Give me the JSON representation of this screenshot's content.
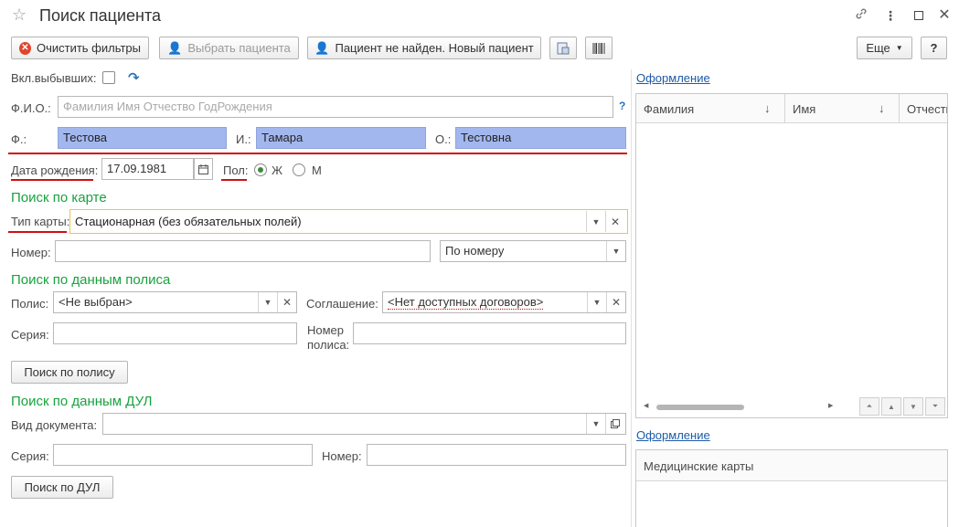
{
  "window": {
    "title": "Поиск пациента",
    "icons": {
      "favorite": "star-icon",
      "link": "link-icon",
      "menu": "more-vertical-icon",
      "maximize": "maximize-icon",
      "close": "close-icon"
    }
  },
  "toolbar": {
    "clear_filters": "Очистить фильтры",
    "select_patient": "Выбрать пациента",
    "new_patient": "Пациент не найден. Новый пациент",
    "more": "Еще",
    "help": "?"
  },
  "form": {
    "include_retired_label": "Вкл.выбывших:",
    "fio_label": "Ф.И.О.:",
    "fio_placeholder": "Фамилия Имя Отчество ГодРождения",
    "help_mark": "?",
    "last_name_label": "Ф.:",
    "last_name_value": "Тестова",
    "first_name_label": "И.:",
    "first_name_value": "Тамара",
    "middle_name_label": "О.:",
    "middle_name_value": "Тестовна",
    "birth_date_label": "Дата рождения:",
    "birth_date_value": "17.09.1981",
    "gender_label": "Пол:",
    "gender_female": "Ж",
    "gender_male": "М",
    "gender_selected": "Ж"
  },
  "card_search": {
    "section_title": "Поиск по  карте",
    "card_type_label": "Тип карты:",
    "card_type_value": "Стационарная (без обязательных полей)",
    "number_label": "Номер:",
    "number_value": "",
    "search_by_value": "По номеру"
  },
  "policy_search": {
    "section_title": "Поиск по данным полиса",
    "policy_label": "Полис:",
    "policy_value": "<Не выбран>",
    "agreement_label": "Соглашение:",
    "agreement_value": "<Нет доступных договоров>",
    "series_label": "Серия:",
    "policy_number_label_1": "Номер",
    "policy_number_label_2": "полиса:",
    "button": "Поиск по полису"
  },
  "dul_search": {
    "section_title": "Поиск по данным ДУЛ",
    "doc_type_label": "Вид документа:",
    "series_label": "Серия:",
    "number_label": "Номер:",
    "button": "Поиск по ДУЛ"
  },
  "patients_grid": {
    "link": "Оформление",
    "columns": [
      "Фамилия",
      "Имя",
      "Отчеств"
    ]
  },
  "cards_grid": {
    "link": "Оформление",
    "columns": [
      "Медицинские карты"
    ]
  },
  "colors": {
    "accent_green": "#18a23f",
    "highlight_blue": "#a3b7ef",
    "annotation_red": "#d01010",
    "focus_yellow": "#f0c24a",
    "link_blue": "#1c5ba8"
  }
}
